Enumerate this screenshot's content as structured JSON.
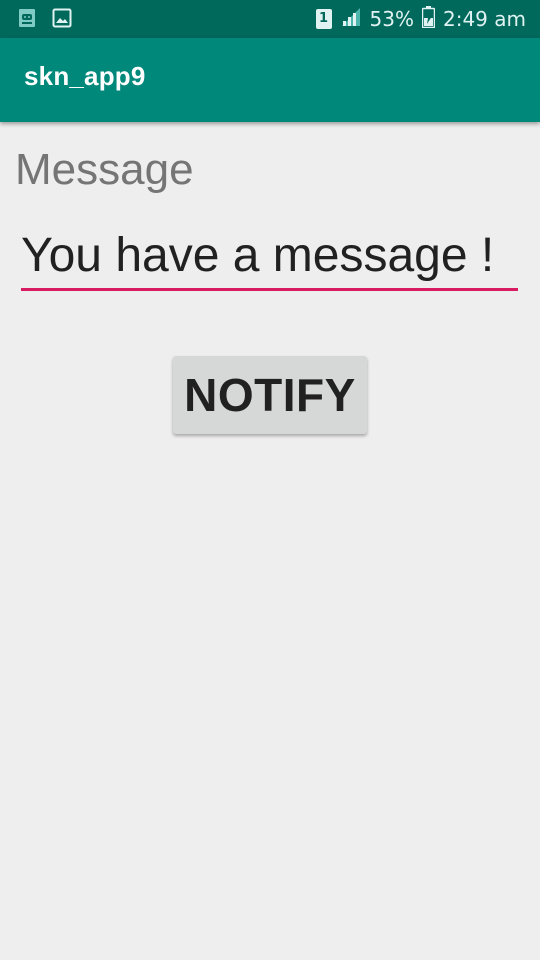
{
  "status_bar": {
    "left_icons": [
      "android-debug-icon",
      "image-icon"
    ],
    "sim_slot": "1",
    "signal_icon": "signal-icon",
    "battery_percent": "53%",
    "battery_icon": "battery-charging-icon",
    "time": "2:49 am"
  },
  "app_bar": {
    "title": "skn_app9",
    "color": "#00897b"
  },
  "form": {
    "label": "Message",
    "input_value": "You have a message !",
    "underline_color": "#d81b60"
  },
  "actions": {
    "notify_label": "NOTIFY"
  }
}
